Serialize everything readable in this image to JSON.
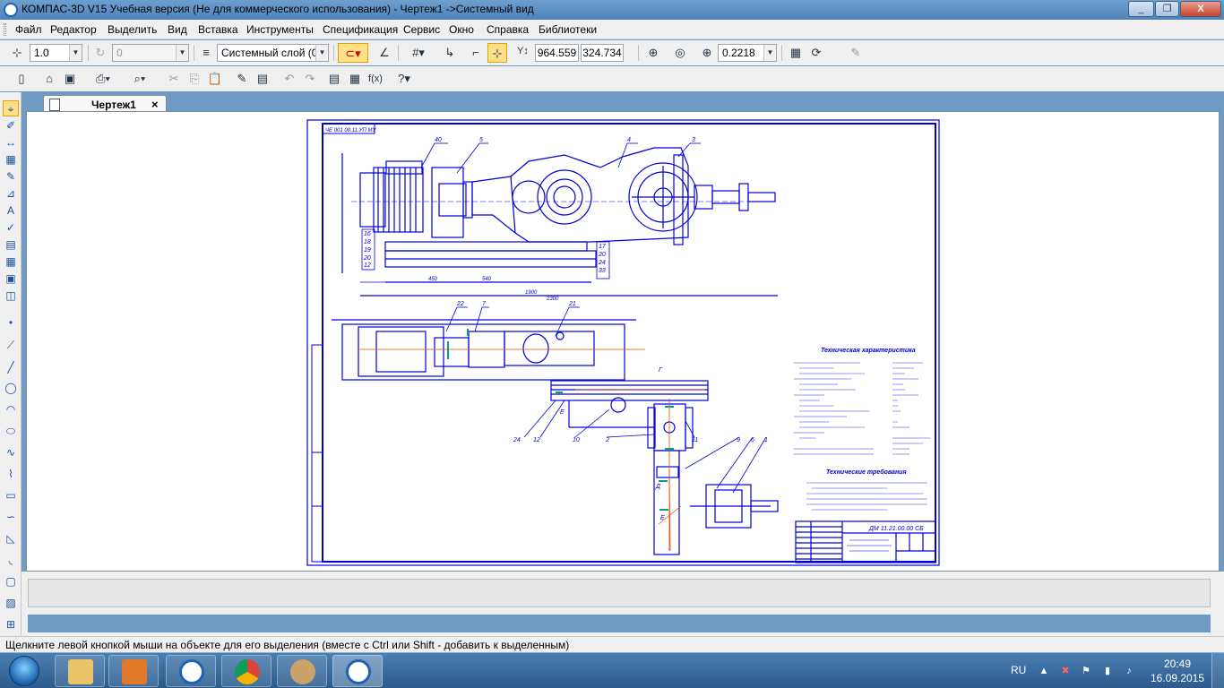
{
  "window": {
    "title": "КОМПАС-3D V15 Учебная версия (Не для коммерческого использования) - Чертеж1 ->Системный вид",
    "minimize": "_",
    "restore": "❐",
    "close": "X"
  },
  "menu": [
    "Файл",
    "Редактор",
    "Выделить",
    "Вид",
    "Вставка",
    "Инструменты",
    "Спецификация",
    "Сервис",
    "Окно",
    "Справка",
    "Библиотеки"
  ],
  "toolbar1": {
    "scale": "1.0",
    "angle": "0",
    "layer": "Системный слой (0)",
    "coord_x": "964.559",
    "coord_y": "324.734",
    "zoom": "0.2218"
  },
  "tab": {
    "label": "Чертеж1",
    "close": "×"
  },
  "drawing": {
    "stamp_top": "ЧЕ 001 00.11.УП МУ",
    "tech_title": "Техническая характеристика",
    "req_title": "Технические требования",
    "doc_code": "ДМ 11.21.00.00 СБ",
    "section_labels": [
      "Г",
      "Е",
      "Д",
      "Е"
    ],
    "callouts": [
      "40",
      "5",
      "4",
      "3",
      "16",
      "18",
      "19",
      "20",
      "12",
      "17",
      "20",
      "24",
      "33",
      "22",
      "7",
      "21",
      "24",
      "12",
      "10",
      "2",
      "11",
      "9",
      "6",
      "1"
    ],
    "dims": [
      "2300",
      "1900",
      "450",
      "540",
      "380"
    ]
  },
  "statusbar": {
    "text": "Щелкните левой кнопкой мыши на объекте для его выделения (вместе с Ctrl или Shift - добавить к выделенным)"
  },
  "taskbar": {
    "lang": "RU",
    "time": "20:49",
    "date": "16.09.2015"
  }
}
